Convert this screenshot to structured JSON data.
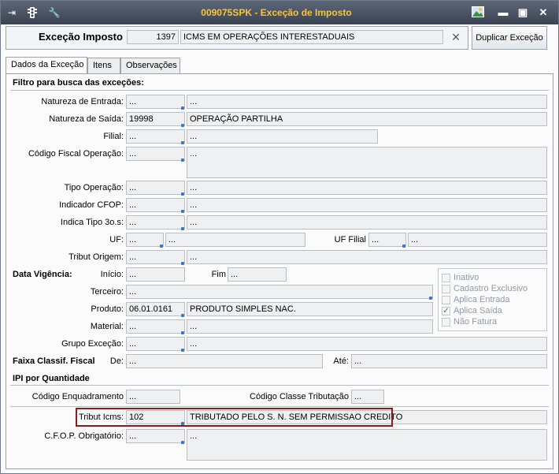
{
  "window": {
    "title": "009075SPK - Exceção de Imposto"
  },
  "header": {
    "label": "Exceção Imposto",
    "code": "1397",
    "description": "ICMS EM OPERAÇÕES INTERESTADUAIS",
    "duplicate_button": "Duplicar Exceção"
  },
  "tabs": [
    "Dados da Exceção",
    "Itens",
    "Observações"
  ],
  "filter": {
    "section_title": "Filtro para busca das exceções:",
    "natureza_entrada": {
      "label": "Natureza de Entrada:",
      "code": "...",
      "desc": "..."
    },
    "natureza_saida": {
      "label": "Natureza de Saída:",
      "code": "19998",
      "desc": "OPERAÇÃO PARTILHA"
    },
    "filial": {
      "label": "Filial:",
      "code": "...",
      "desc": "..."
    },
    "cfop": {
      "label": "Código Fiscal Operação:",
      "code": "...",
      "desc": "..."
    },
    "tipo_operacao": {
      "label": "Tipo Operação:",
      "code": "...",
      "desc": "..."
    },
    "indicador_cfop": {
      "label": "Indicador CFOP:",
      "code": "...",
      "desc": "..."
    },
    "indica_tipo": {
      "label": "Indica Tipo 3o.s:",
      "code": "...",
      "desc": "..."
    },
    "uf": {
      "label": "UF:",
      "code": "...",
      "desc": "..."
    },
    "uf_filial": {
      "label": "UF Filial",
      "code": "...",
      "desc": "..."
    },
    "tribut_origem": {
      "label": "Tribut Origem:",
      "code": "...",
      "desc": "..."
    }
  },
  "vigencia": {
    "title": "Data Vigência:",
    "inicio_label": "Início:",
    "inicio": "...",
    "fim_label": "Fim",
    "fim": "..."
  },
  "terceiro": {
    "label": "Terceiro:",
    "value": "..."
  },
  "produto": {
    "label": "Produto:",
    "code": "06.01.0161",
    "desc": "PRODUTO SIMPLES NAC."
  },
  "material": {
    "label": "Material:",
    "code": "...",
    "desc": "..."
  },
  "grupo_excecao": {
    "label": "Grupo Exceção:",
    "code": "...",
    "desc": "..."
  },
  "faixa": {
    "title": "Faixa Classif. Fiscal",
    "de_label": "De:",
    "de": "...",
    "ate_label": "Até:",
    "ate": "..."
  },
  "checkboxes": [
    {
      "label": "Inativo",
      "checked": false
    },
    {
      "label": "Cadastro Exclusivo",
      "checked": false
    },
    {
      "label": "Aplica Entrada",
      "checked": false
    },
    {
      "label": "Aplica Saída",
      "checked": true
    },
    {
      "label": "Não Fatura",
      "checked": false
    }
  ],
  "ipi": {
    "title": "IPI por Quantidade",
    "enq_label": "Código Enquadramento",
    "enq": "...",
    "classe_label": "Código Classe Tributação",
    "classe": "..."
  },
  "tribut_icms": {
    "label": "Tribut Icms:",
    "code": "102",
    "desc": "TRIBUTADO PELO S. N. SEM PERMISSAO CREDITO"
  },
  "cfop_obrig": {
    "label": "C.F.O.P. Obrigatório:",
    "code": "...",
    "desc": "..."
  },
  "icons": {
    "close": "×",
    "check": "✓"
  }
}
